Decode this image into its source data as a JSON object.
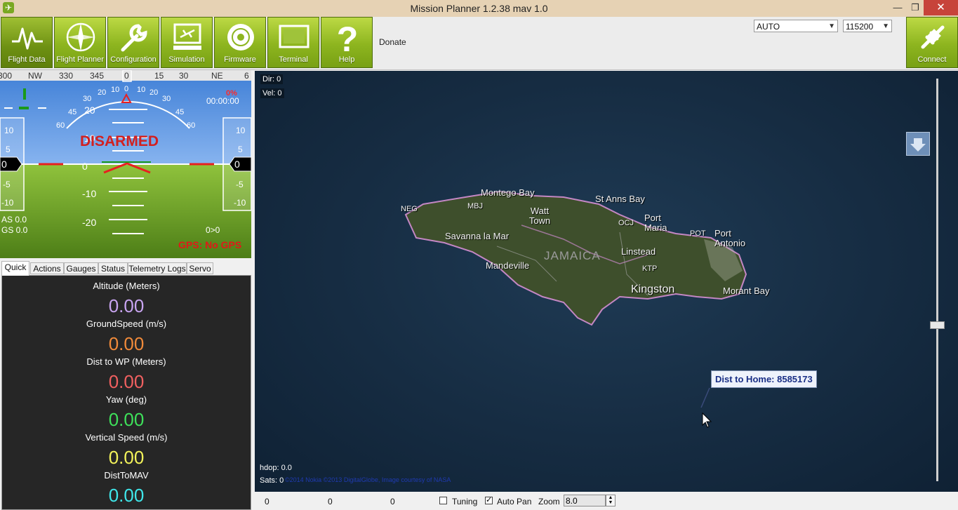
{
  "window": {
    "title": "Mission Planner 1.2.38 mav 1.0",
    "minimize": "—",
    "restore": "❐",
    "close": "✕"
  },
  "toolbar": {
    "buttons": [
      {
        "label": "Flight Data",
        "icon": "flight-data-icon"
      },
      {
        "label": "Flight Planner",
        "icon": "compass-icon"
      },
      {
        "label": "Configuration",
        "icon": "wrench-icon"
      },
      {
        "label": "Simulation",
        "icon": "simulation-icon"
      },
      {
        "label": "Firmware",
        "icon": "disc-icon"
      },
      {
        "label": "Terminal",
        "icon": "terminal-icon"
      },
      {
        "label": "Help",
        "icon": "help-icon"
      }
    ],
    "donate": "Donate",
    "port_select": "AUTO",
    "baud_select": "115200",
    "connect_label": "Connect"
  },
  "hud": {
    "heading_ticks": [
      "300",
      "NW",
      "330",
      "345",
      "0",
      "15",
      "30",
      "NE",
      "6"
    ],
    "status": "DISARMED",
    "airspeed": "AS 0.0",
    "groundspeed": "GS 0.0",
    "wp": "0>0",
    "gps": "GPS: No GPS",
    "timer": "00:00:00",
    "battery": "0%",
    "left_tape": [
      "10",
      "5",
      "0",
      "-5",
      "-10"
    ],
    "right_tape": [
      "10",
      "5",
      "0",
      "-5",
      "-10"
    ],
    "pitch_labels": [
      "20",
      "10",
      "0",
      "-10",
      "-20"
    ],
    "roll_labels": [
      "60",
      "45",
      "30",
      "20",
      "10",
      "0",
      "10",
      "20",
      "30",
      "45",
      "60"
    ]
  },
  "tabs": [
    "Quick",
    "Actions",
    "Gauges",
    "Status",
    "Telemetry Logs",
    "Servo"
  ],
  "quick": [
    {
      "label": "Altitude (Meters)",
      "value": "0.00",
      "color": "#c8a4f0"
    },
    {
      "label": "GroundSpeed (m/s)",
      "value": "0.00",
      "color": "#f08a3a"
    },
    {
      "label": "Dist to WP (Meters)",
      "value": "0.00",
      "color": "#f06060"
    },
    {
      "label": "Yaw (deg)",
      "value": "0.00",
      "color": "#3ee05a"
    },
    {
      "label": "Vertical Speed (m/s)",
      "value": "0.00",
      "color": "#f2f25a"
    },
    {
      "label": "DistToMAV",
      "value": "0.00",
      "color": "#3fe6ea"
    }
  ],
  "map": {
    "dir": "Dir: 0",
    "vel": "Vel: 0",
    "hdop": "hdop: 0.0",
    "sats": "Sats: 0",
    "dist_home": "Dist to Home: 8585173",
    "copyright": "©2014 Nokia  ©2013 DigitalGlobe, Image courtesy of NASA",
    "labels": [
      "Montego Bay",
      "MBJ",
      "NEG",
      "Watt Town",
      "St Anns Bay",
      "OCJ",
      "Port Maria",
      "POT",
      "Port Antonio",
      "Savanna la Mar",
      "JAMAICA",
      "Mandeville",
      "Linstead",
      "KTP",
      "Kingston",
      "Morant Bay"
    ]
  },
  "bottom": {
    "v1": "0",
    "v2": "0",
    "v3": "0",
    "tuning": "Tuning",
    "auto_pan": "Auto Pan",
    "zoom_label": "Zoom",
    "zoom_value": "8.0"
  }
}
